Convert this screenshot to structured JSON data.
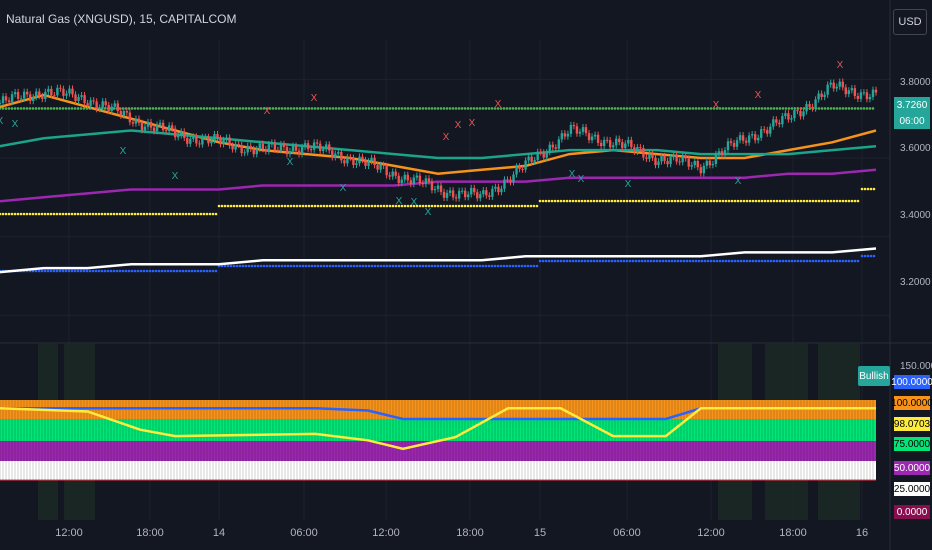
{
  "header": {
    "title": "Natural Gas (XNGUSD), 15, CAPITALCOM",
    "currency": "USD"
  },
  "price_box": {
    "value": "3.7260",
    "countdown": "06:00"
  },
  "signal_label": "Bullish",
  "colors": {
    "bg": "#131722",
    "up": "#26a69a",
    "down": "#ef5350",
    "orange": "#f7931a",
    "teal": "#1aa48a",
    "purple": "#9c27b0",
    "yellow": "#ffeb3b",
    "blue": "#2962ff",
    "white": "#ffffff",
    "green": "#00e676"
  },
  "chart_data": [
    {
      "type": "line",
      "title": "Natural Gas (XNGUSD), 15, CAPITALCOM",
      "y_ticks": [
        "3.8000",
        "3.6000",
        "3.4000",
        "3.2000"
      ],
      "ylim": [
        3.15,
        3.9
      ],
      "x_ticks": [
        "12:00",
        "18:00",
        "14",
        "06:00",
        "12:00",
        "18:00",
        "15",
        "06:00",
        "12:00",
        "18:00",
        "16"
      ],
      "last_price": 3.726,
      "x": [
        0,
        5,
        10,
        15,
        20,
        25,
        30,
        35,
        40,
        45,
        50,
        55,
        60,
        65,
        70,
        75,
        80,
        85,
        90,
        95,
        100
      ],
      "series": [
        {
          "color_key": "up",
          "close": [
            3.74,
            3.77,
            3.75,
            3.7,
            3.66,
            3.64,
            3.62,
            3.63,
            3.6,
            3.56,
            3.52,
            3.5,
            3.58,
            3.67,
            3.64,
            3.6,
            3.58,
            3.65,
            3.7,
            3.78,
            3.76
          ]
        },
        {
          "color_key": "orange",
          "values": [
            3.73,
            3.76,
            3.73,
            3.7,
            3.67,
            3.64,
            3.62,
            3.61,
            3.6,
            3.58,
            3.56,
            3.57,
            3.58,
            3.61,
            3.62,
            3.61,
            3.6,
            3.6,
            3.62,
            3.64,
            3.67
          ]
        },
        {
          "color_key": "teal",
          "values": [
            3.63,
            3.65,
            3.66,
            3.67,
            3.66,
            3.65,
            3.64,
            3.63,
            3.62,
            3.61,
            3.6,
            3.6,
            3.61,
            3.62,
            3.62,
            3.62,
            3.61,
            3.61,
            3.61,
            3.62,
            3.63
          ]
        },
        {
          "color_key": "purple",
          "values": [
            3.49,
            3.5,
            3.51,
            3.52,
            3.52,
            3.52,
            3.53,
            3.53,
            3.53,
            3.53,
            3.54,
            3.54,
            3.54,
            3.55,
            3.55,
            3.55,
            3.55,
            3.55,
            3.56,
            3.56,
            3.57
          ]
        },
        {
          "color_key": "white",
          "values": [
            3.31,
            3.32,
            3.32,
            3.33,
            3.33,
            3.33,
            3.34,
            3.34,
            3.34,
            3.34,
            3.34,
            3.34,
            3.35,
            3.35,
            3.35,
            3.35,
            3.35,
            3.36,
            3.36,
            3.36,
            3.37
          ]
        }
      ]
    },
    {
      "type": "line",
      "y_ticks": [
        "150.0000"
      ],
      "ylim": [
        0,
        150
      ],
      "labels": [
        "100.0000",
        "100.0000",
        "98.0703",
        "75.0000",
        "50.0000",
        "25.0000",
        "0.0000"
      ],
      "x": [
        0,
        10,
        16,
        20,
        28,
        36,
        42,
        46,
        52,
        58,
        64,
        70,
        76,
        80,
        90,
        100
      ],
      "series": [
        {
          "color_key": "yellow",
          "values": [
            100,
            97,
            80,
            74,
            75,
            76,
            70,
            62,
            73,
            100,
            100,
            74,
            74,
            100,
            100,
            100
          ]
        },
        {
          "color_key": "blue",
          "values": [
            100,
            100,
            100,
            100,
            100,
            100,
            98,
            90,
            90,
            90,
            90,
            90,
            90,
            100,
            100,
            100
          ]
        }
      ]
    }
  ]
}
